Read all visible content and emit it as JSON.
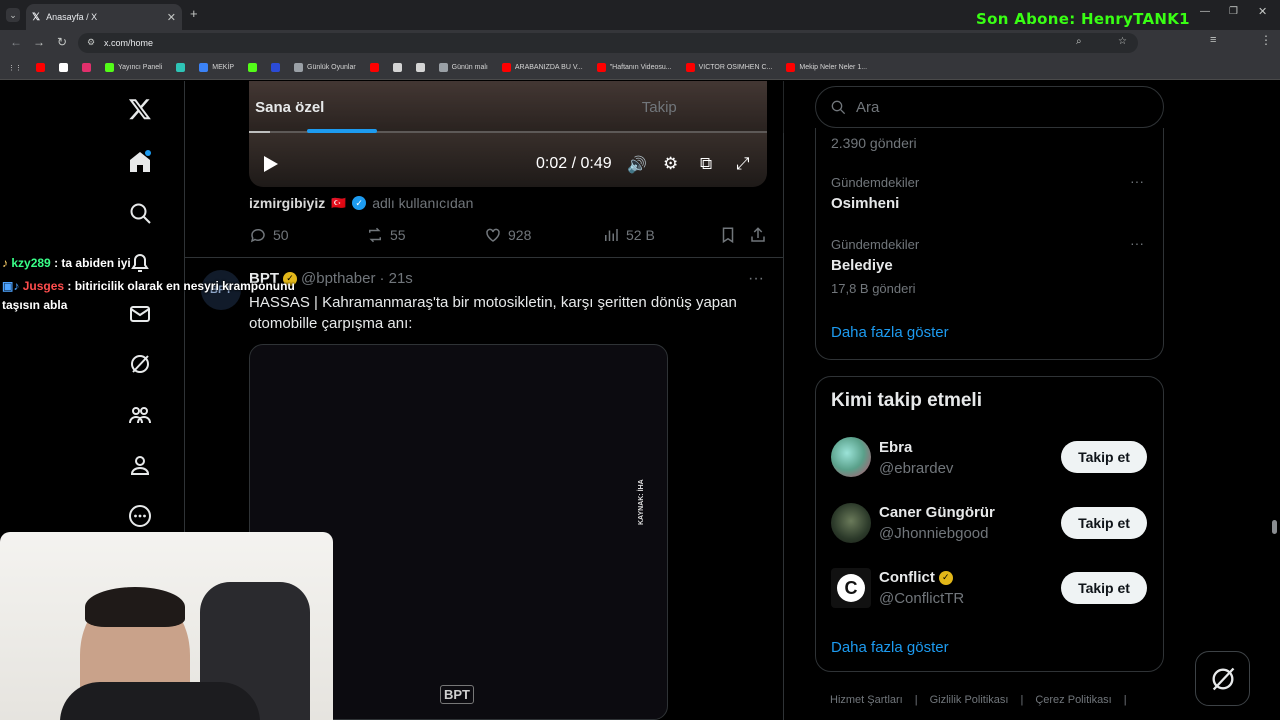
{
  "overlay": {
    "title": "Son Abone: HenryTANK1"
  },
  "browser": {
    "tab_title": "Anasayfa / X",
    "url": "x.com/home",
    "bookmarks": [
      {
        "label": "",
        "color": "#ff0000"
      },
      {
        "label": "",
        "color": "#ffffff"
      },
      {
        "label": "",
        "color": "#e1306c"
      },
      {
        "label": "Yayıncı Paneli",
        "color": "#53fc18"
      },
      {
        "label": "",
        "color": "#2ec4b6"
      },
      {
        "label": "MEKİP",
        "color": "#3b82f6"
      },
      {
        "label": "",
        "color": "#53fc18"
      },
      {
        "label": "",
        "color": "#2b4bd6"
      },
      {
        "label": "Günlük Oyunlar",
        "color": "#9aa0a6"
      },
      {
        "label": "",
        "color": "#ff0000"
      },
      {
        "label": "",
        "color": "#d4d4d4"
      },
      {
        "label": "",
        "color": "#d4d4d4"
      },
      {
        "label": "Günün malı",
        "color": "#9aa0a6"
      },
      {
        "label": "ARABANIZDA BU V...",
        "color": "#ff0000"
      },
      {
        "label": "\"Haftanın Videosu...",
        "color": "#ff0000"
      },
      {
        "label": "VICTOR OSIMHEN C...",
        "color": "#ff0000"
      },
      {
        "label": "Mekip Neler Neler 1...",
        "color": "#ff0000"
      }
    ]
  },
  "feed": {
    "tabs": [
      {
        "label": "Sana özel",
        "active": true
      },
      {
        "label": "Takip",
        "active": false
      }
    ],
    "video": {
      "time": "0:02 / 0:49",
      "progress": 0.04
    },
    "prev_post": {
      "author": "izmirgibiyiz",
      "flag": "🇹🇷",
      "suffix": "adlı kullanıcıdan",
      "replies": "50",
      "reposts": "55",
      "likes": "928",
      "views": "52 B"
    },
    "post": {
      "author": "BPT",
      "handle": "@bpthaber",
      "time": "· 21s",
      "text": "HASSAS | Kahramanmaraş'ta bir motosikletin, karşı şeritten dönüş yapan otomobille çarpışma anı:",
      "media_caption": "KAYNAK: İHA",
      "media_logo": "BPT"
    }
  },
  "sidebar": {
    "search_placeholder": "Ara",
    "trends": [
      {
        "category": "",
        "name": "",
        "count": "2.390 gönderi"
      },
      {
        "category": "Gündemdekiler",
        "name": "Osimheni",
        "count": ""
      },
      {
        "category": "Gündemdekiler",
        "name": "Belediye",
        "count": "17,8 B gönderi"
      }
    ],
    "trends_more": "Daha fazla göster",
    "who_to_follow": {
      "title": "Kimi takip etmeli",
      "users": [
        {
          "name": "Ebra",
          "handle": "@ebrardev",
          "verified": false,
          "button": "Takip et"
        },
        {
          "name": "Caner Güngörür",
          "handle": "@Jhonniebgood",
          "verified": false,
          "button": "Takip et"
        },
        {
          "name": "Conflict",
          "handle": "@ConflictTR",
          "verified": true,
          "button": "Takip et"
        }
      ],
      "more": "Daha fazla göster"
    },
    "footer": [
      "Hizmet Şartları",
      "Gizlilik Politikası",
      "Çerez Politikası"
    ]
  },
  "chat": [
    {
      "user": "kzy289",
      "color": "#39ff88",
      "text": ": ta abiden iyi"
    },
    {
      "user": "Jusges",
      "color": "#ff4d4d",
      "text": ": bitiricilik olarak en nesyri kramponunu taşısın abla"
    }
  ]
}
